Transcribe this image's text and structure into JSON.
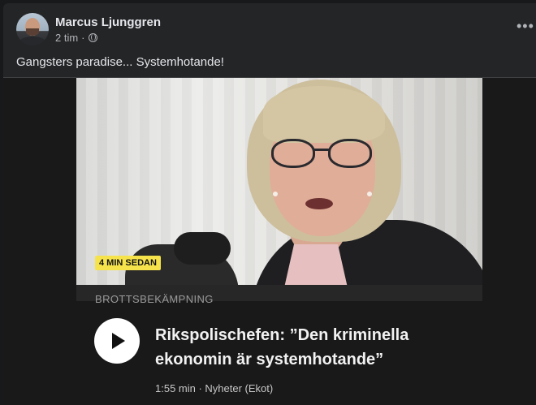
{
  "post": {
    "author": "Marcus Ljunggren",
    "time": "2 tim",
    "separator": "·",
    "audience_icon": "globe-icon",
    "more_label": "•••",
    "text": "Gangsters paradise... Systemhotande!"
  },
  "link_card": {
    "time_badge": "4 MIN SEDAN",
    "category": "BROTTSBEKÄMPNING",
    "headline_line1": "Rikspolischefen: ”Den kriminella",
    "headline_line2": "ekonomin är systemhotande”",
    "audio_meta": "1:55 min · Nyheter (Ekot)",
    "play_icon": "play-icon"
  },
  "colors": {
    "background": "#18191a",
    "card": "#242526",
    "badge": "#f6e34c",
    "text_primary": "#e4e6eb",
    "text_secondary": "#b0b3b8"
  }
}
